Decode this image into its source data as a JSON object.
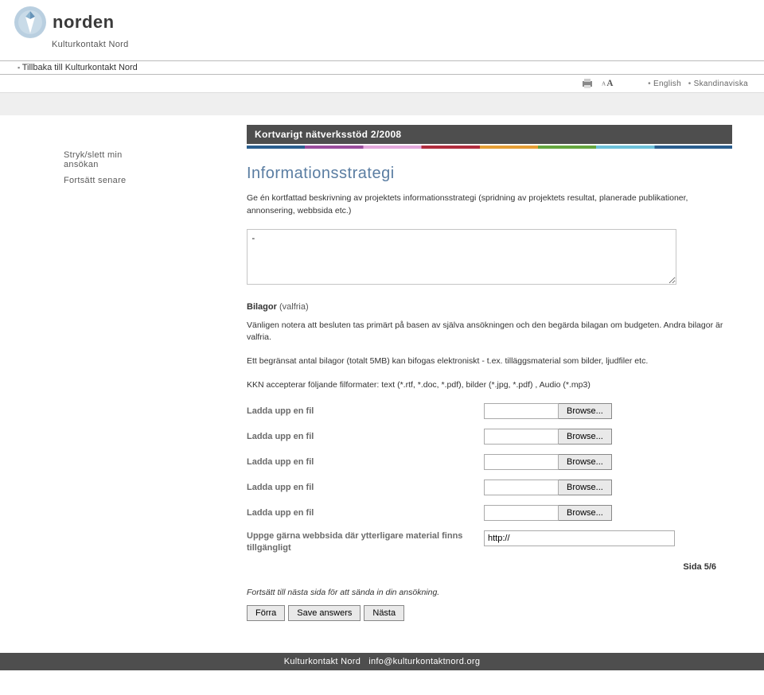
{
  "header": {
    "brand": "norden",
    "sub": "Kulturkontakt Nord"
  },
  "nav": {
    "back": "Tillbaka till Kulturkontakt Nord",
    "langs": [
      "English",
      "Skandinaviska"
    ]
  },
  "sidebar": {
    "items": [
      "Stryk/slett min ansökan",
      "Fortsätt senare"
    ]
  },
  "page": {
    "bar_title": "Kortvarigt nätverksstöd 2/2008",
    "heading": "Informationsstrategi",
    "desc": "Ge én kortfattad beskrivning av projektets informationsstrategi (spridning av projektets resultat, planerade publikationer, annonsering, webbsida etc.)",
    "textarea_value": "-"
  },
  "attachments": {
    "heading": "Bilagor",
    "heading_suffix": "(valfria)",
    "p1": "Vänligen notera att besluten tas primärt på basen av själva ansökningen och  den begärda bilagan om budgeten. Andra bilagor är valfria.",
    "p2": "Ett begränsat antal bilagor (totalt 5MB) kan bifogas elektroniskt - t.ex. tilläggsmaterial som bilder, ljudfiler etc.",
    "p3": "KKN accepterar följande filformater: text (*.rtf, *.doc, *.pdf), bilder (*.jpg, *.pdf) , Audio (*.mp3)",
    "upload_label": "Ladda upp en fil",
    "browse_label": "Browse...",
    "url_label": "Uppge gärna webbsida där ytterligare material finns tillgängligt",
    "url_value": "http://"
  },
  "pager": "Sida 5/6",
  "continue": "Fortsätt till nästa sida för att sända in din ansökning.",
  "buttons": {
    "prev": "Förra",
    "save": "Save answers",
    "next": "Nästa"
  },
  "footer": {
    "org": "Kulturkontakt Nord",
    "email": "info@kulturkontaktnord.org"
  }
}
